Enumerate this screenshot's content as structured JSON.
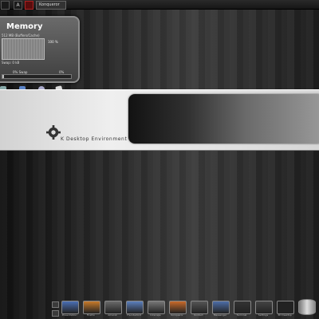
{
  "topbar": {
    "buttons": [
      "",
      "A",
      ""
    ],
    "task_label": "Konqueror"
  },
  "memory_widget": {
    "title": "Memory",
    "subtitle": "512 MB (Buffers/Cache)",
    "percent_top": "100 %",
    "line2": "Swap: 0 kB",
    "swap_left": "0%",
    "swap_mid": "Swap",
    "percent_bottom": "0%",
    "swap_fill_fraction": 0.02,
    "icons": [
      "monitor-icon",
      "refresh-icon",
      "clock-icon",
      "note-icon"
    ]
  },
  "banner": {
    "text": "K Desktop Environment"
  },
  "dock": {
    "items": [
      {
        "name": "presentation",
        "label": "Presentation",
        "color": "#4a6fb5"
      },
      {
        "name": "firefox",
        "label": "Firefox",
        "color": "#c77a2a"
      },
      {
        "name": "amarok",
        "label": "Amarok",
        "color": "#6a6a6a"
      },
      {
        "name": "thunderbird",
        "label": "Thunderbird",
        "color": "#5b7fbd"
      },
      {
        "name": "inkscape",
        "label": "Inkscape",
        "color": "#777"
      },
      {
        "name": "konqueror",
        "label": "Konqueror",
        "color": "#c86a2a"
      },
      {
        "name": "kontact",
        "label": "Kontact",
        "color": "#555"
      },
      {
        "name": "messenger",
        "label": "Messenger",
        "color": "#4d6ea8"
      },
      {
        "name": "terminal",
        "label": "Terminal",
        "color": "#333"
      },
      {
        "name": "settings",
        "label": "Settings",
        "color": "#444"
      },
      {
        "name": "3d-desktop",
        "label": "3D Desktop",
        "color": "#222"
      },
      {
        "name": "trash",
        "label": "",
        "color": "#999"
      }
    ]
  }
}
